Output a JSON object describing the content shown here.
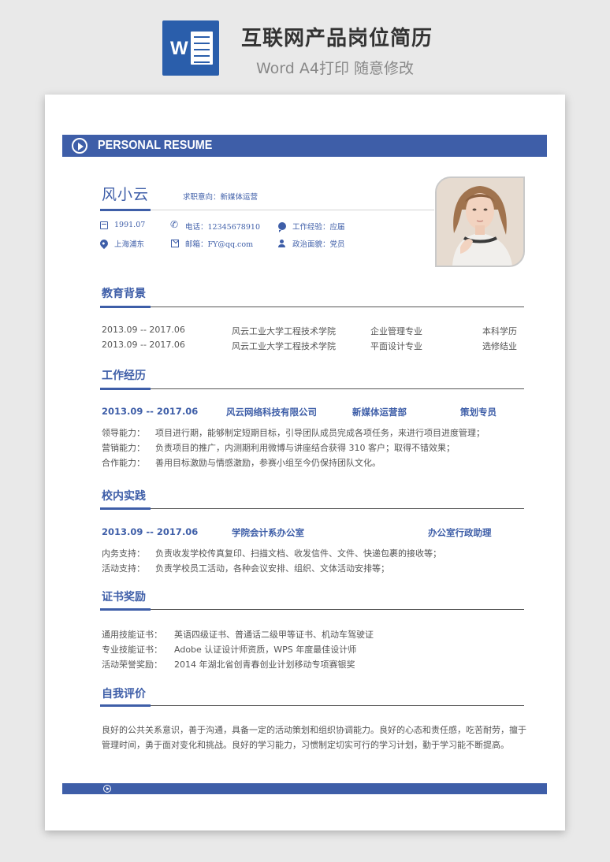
{
  "promo": {
    "title": "互联网产品岗位简历",
    "subtitle": "Word A4打印 随意修改",
    "logo_letter": "W"
  },
  "banner": {
    "title": "PERSONAL RESUME",
    "icon": "play-circle-icon"
  },
  "profile": {
    "name": "风小云",
    "objective": "求职意向：新媒体运营",
    "birth": "1991.07",
    "phone": "电话：12345678910",
    "experience": "工作经验：应届",
    "location": "上海浦东",
    "email": "邮箱：FY@qq.com",
    "political": "政治面貌：党员"
  },
  "education": {
    "title": "教育背景",
    "rows": [
      {
        "period": "2013.09 -- 2017.06",
        "school": "风云工业大学工程技术学院",
        "major": "企业管理专业",
        "degree": "本科学历"
      },
      {
        "period": "2013.09 -- 2017.06",
        "school": "风云工业大学工程技术学院",
        "major": "平面设计专业",
        "degree": "选修结业"
      }
    ]
  },
  "work": {
    "title": "工作经历",
    "period": "2013.09 -- 2017.06",
    "company": "风云网络科技有限公司",
    "department": "新媒体运营部",
    "position": "策划专员",
    "items": [
      {
        "label": "领导能力：",
        "text": "项目进行期，能够制定短期目标，引导团队成员完成各项任务，来进行项目进度管理；"
      },
      {
        "label": "营销能力：",
        "text": "负责项目的推广，内测期利用微博与讲座结合获得 310 客户；取得不错效果；"
      },
      {
        "label": "合作能力：",
        "text": "善用目标激励与情感激励，参赛小组至今仍保持团队文化。"
      }
    ]
  },
  "campus": {
    "title": "校内实践",
    "period": "2013.09 -- 2017.06",
    "org": "学院会计系办公室",
    "position": "办公室行政助理",
    "items": [
      {
        "label": "内务支持：",
        "text": "负责收发学校传真复印、扫描文档、收发信件、文件、快递包裹的接收等；"
      },
      {
        "label": "活动支持：",
        "text": "负责学校员工活动，各种会议安排、组织、文体活动安排等；"
      }
    ]
  },
  "certs": {
    "title": "证书奖励",
    "items": [
      {
        "label": "通用技能证书：",
        "text": "英语四级证书、普通话二级甲等证书、机动车驾驶证"
      },
      {
        "label": "专业技能证书：",
        "text": "Adobe 认证设计师资质，WPS 年度最佳设计师"
      },
      {
        "label": "活动荣誉奖励：",
        "text": "2014 年湖北省创青春创业计划移动专项赛银奖"
      }
    ]
  },
  "self_eval": {
    "title": "自我评价",
    "text": "良好的公共关系意识，善于沟通，具备一定的活动策划和组织协调能力。良好的心态和责任感，吃苦耐劳，擅于管理时间，勇于面对变化和挑战。良好的学习能力，习惯制定切实可行的学习计划，勤于学习能不断提高。"
  },
  "colors": {
    "accent": "#3e5ea8",
    "word_blue": "#2a5eab"
  }
}
